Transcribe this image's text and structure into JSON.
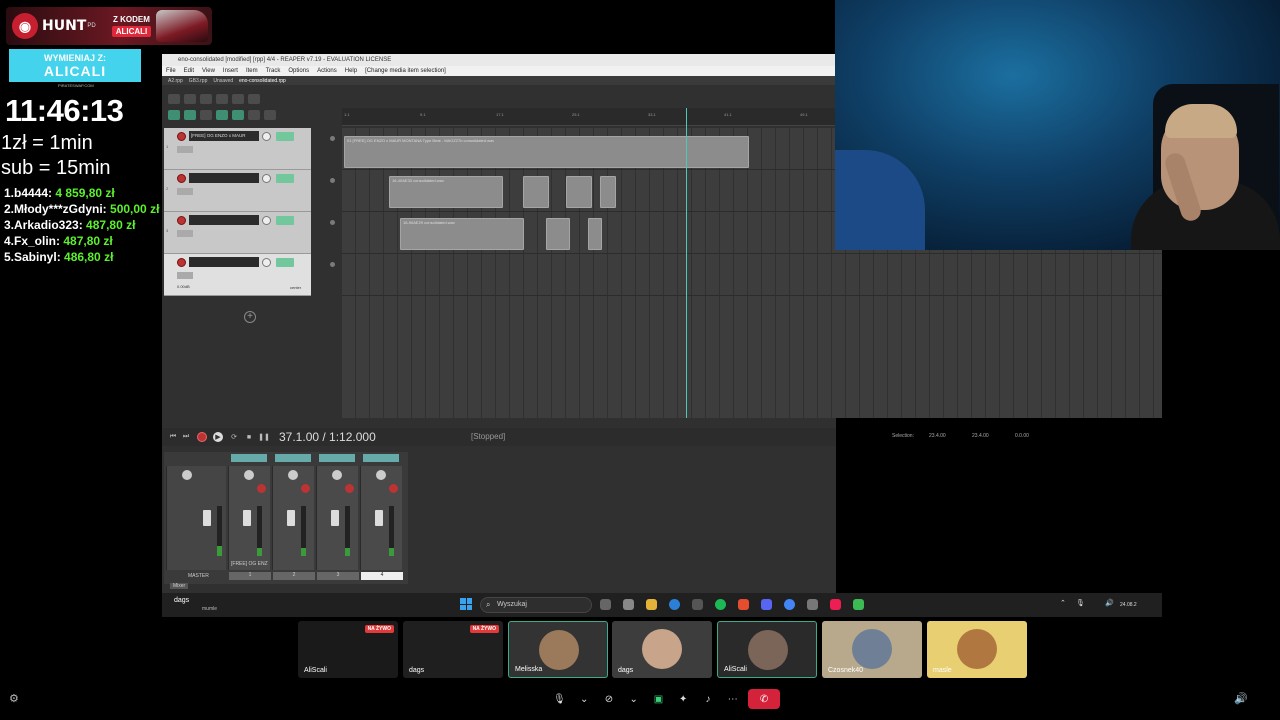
{
  "overlay": {
    "hunt_brand": "HUNT",
    "hunt_brand_suffix": "PD",
    "hunt_code_label": "Z KODEM",
    "hunt_code": "ALICALI",
    "exchange_label": "WYMIENIAJ Z:",
    "exchange_code": "ALICALI",
    "exchange_site": "PIRATESWAP.COM",
    "timer": "11:46:13",
    "rate_donation": "1zł = 1min",
    "rate_sub": "sub = 15min",
    "leaderboard": [
      {
        "name": "1.b4444:",
        "amount": "4 859,80 zł"
      },
      {
        "name": "2.Młody***zGdyni:",
        "amount": "500,00 zł"
      },
      {
        "name": "3.Arkadio323:",
        "amount": "487,80 zł"
      },
      {
        "name": "4.Fx_olin:",
        "amount": "487,80 zł"
      },
      {
        "name": "5.Sabinyl:",
        "amount": "486,80 zł"
      }
    ]
  },
  "reaper": {
    "title": "eno-consolidated [modified] [rpp] 4/4 - REAPER v7.19 - EVALUATION LICENSE",
    "menu": [
      "File",
      "Edit",
      "View",
      "Insert",
      "Item",
      "Track",
      "Options",
      "Actions",
      "Help",
      "[Change media item selection]"
    ],
    "tabs": [
      "A2.rpp",
      "GB3.rpp",
      "Unsaved",
      "eno-consolidated.rpp"
    ],
    "ruler_ticks": [
      "1.1",
      "9.1",
      "17.1",
      "25.1",
      "33.1",
      "41.1",
      "49.1",
      "57.1"
    ],
    "tracks": [
      {
        "name": "[FREE] OG ENZO x MAUR",
        "num": "1"
      },
      {
        "name": "",
        "num": "2"
      },
      {
        "name": "",
        "num": "3"
      },
      {
        "name": "",
        "num": "4",
        "vol": "0.00dB",
        "pan": "center"
      }
    ],
    "items": [
      {
        "name": "01 [FREE] OG ENZO x MAUR MONTANA Type Beat - MAGZ27b consolidated.wav"
      },
      {
        "name": "16-40AE33 consolidated.wav"
      },
      {
        "name": "16-90AE29 consolidated.wav"
      }
    ],
    "transport": {
      "time": "37.1.00 / 1:12.000",
      "state": "[Stopped]",
      "selection_label": "Selection:",
      "sel_start": "23.4.00",
      "sel_end": "23.4.00",
      "sel_len": "0.0.00"
    },
    "mixer": {
      "master_label": "MASTER",
      "track_label": "[FREE] OG ENZ",
      "strip_nums": [
        "1",
        "2",
        "3",
        "4"
      ],
      "tab": "Mixer"
    }
  },
  "taskbar": {
    "user": "dags",
    "user_sub": "mumle",
    "search_placeholder": "Wyszukaj",
    "date": "24.08.2"
  },
  "gallery": [
    {
      "name": "AliScali",
      "live": "NA ŻYWO"
    },
    {
      "name": "dags",
      "live": "NA ŻYWO"
    },
    {
      "name": "Melisska",
      "live": ""
    },
    {
      "name": "dags",
      "live": ""
    },
    {
      "name": "AliScali",
      "live": ""
    },
    {
      "name": "Czosnek40",
      "live": ""
    },
    {
      "name": "masle",
      "live": ""
    }
  ],
  "colors": {
    "accent_green": "#5cf02e",
    "exchange_bg": "#43d3ec",
    "leave_red": "#d4223b"
  }
}
